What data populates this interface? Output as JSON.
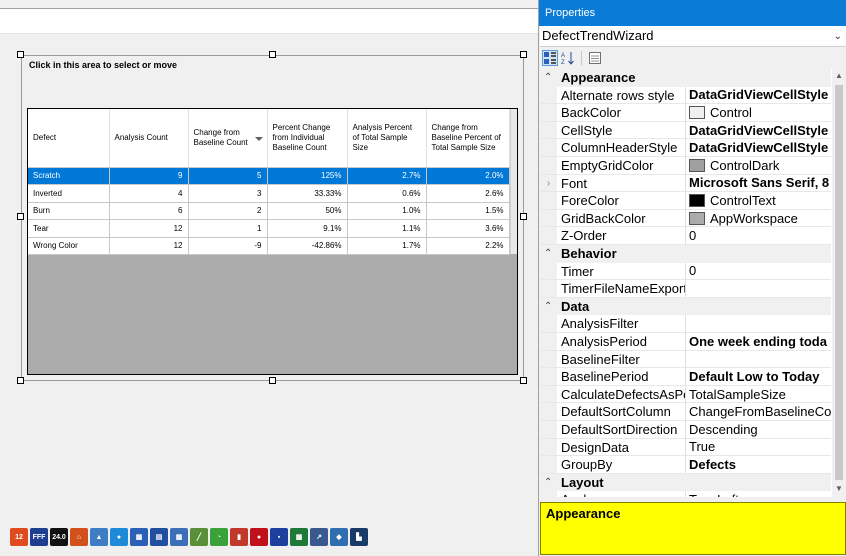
{
  "designer": {
    "select_hint": "Click in this area to select or move",
    "grid": {
      "columns": [
        "Defect",
        "Analysis Count",
        "Change from Baseline Count",
        "Percent Change from Individual Baseline Count",
        "Analysis Percent of Total Sample Size",
        "Change from Baseline Percent of Total Sample Size"
      ],
      "rows": [
        [
          "Scratch",
          "9",
          "5",
          "125%",
          "2.7%",
          "2.0%"
        ],
        [
          "Inverted",
          "4",
          "3",
          "33.33%",
          "0.6%",
          "2.6%"
        ],
        [
          "Burn",
          "6",
          "2",
          "50%",
          "1.0%",
          "1.5%"
        ],
        [
          "Tear",
          "12",
          "1",
          "9.1%",
          "1.1%",
          "3.6%"
        ],
        [
          "Wrong Color",
          "12",
          "-9",
          "-42.86%",
          "1.7%",
          "2.2%"
        ]
      ]
    }
  },
  "toolbox": {
    "icons": [
      {
        "name": "calendar-icon",
        "glyph": "12",
        "color": "#e04a1f"
      },
      {
        "name": "fff-text-icon",
        "glyph": "FFF",
        "color": "#1e3f8f"
      },
      {
        "name": "digital-display-icon",
        "glyph": "24.0",
        "color": "#111111"
      },
      {
        "name": "house-icon",
        "glyph": "⌂",
        "color": "#d1501c"
      },
      {
        "name": "picture-icon",
        "glyph": "▲",
        "color": "#3e7dc4"
      },
      {
        "name": "globe-icon",
        "glyph": "●",
        "color": "#1f8ad8"
      },
      {
        "name": "table-icon",
        "glyph": "▦",
        "color": "#2b5fb8"
      },
      {
        "name": "grid-icon",
        "glyph": "▤",
        "color": "#1f4f9e"
      },
      {
        "name": "datagrid-icon",
        "glyph": "▦",
        "color": "#3d6fb8"
      },
      {
        "name": "line-chart-icon",
        "glyph": "╱",
        "color": "#5a8f3a"
      },
      {
        "name": "gauge-icon",
        "glyph": "◔",
        "color": "#3aa23a"
      },
      {
        "name": "bar-indicator-icon",
        "glyph": "▮",
        "color": "#c0392b"
      },
      {
        "name": "stop-icon",
        "glyph": "●",
        "color": "#c0101a"
      },
      {
        "name": "scatter-icon",
        "glyph": "▪",
        "color": "#1f3f9e"
      },
      {
        "name": "block-grid-icon",
        "glyph": "▦",
        "color": "#1f7a3a"
      },
      {
        "name": "trend-chart-icon",
        "glyph": "↗",
        "color": "#3a5a8f"
      },
      {
        "name": "python-icon",
        "glyph": "◆",
        "color": "#2f6fb0"
      },
      {
        "name": "bar-chart-icon",
        "glyph": "▙",
        "color": "#1a3a6a"
      }
    ]
  },
  "properties": {
    "title": "Properties",
    "object_name": "DefectTrendWizard",
    "toolbar": {
      "categorized": "categorized-icon",
      "alphabetical": "alphabetical-sort-icon",
      "property_pages": "property-pages-icon"
    },
    "rows": [
      {
        "kind": "category",
        "label": "Appearance"
      },
      {
        "kind": "prop",
        "name": "Alternate rows style",
        "value": "DataGridViewCellStyle",
        "bold": true
      },
      {
        "kind": "prop",
        "name": "BackColor",
        "value": "Control",
        "swatch": "#f0f0f0"
      },
      {
        "kind": "prop",
        "name": "CellStyle",
        "value": "DataGridViewCellStyle",
        "bold": true
      },
      {
        "kind": "prop",
        "name": "ColumnHeaderStyle",
        "value": "DataGridViewCellStyle",
        "bold": true
      },
      {
        "kind": "prop",
        "name": "EmptyGridColor",
        "value": "ControlDark",
        "swatch": "#a0a0a0"
      },
      {
        "kind": "prop",
        "name": "Font",
        "value": "Microsoft Sans Serif, 8",
        "bold": true,
        "expandable": true
      },
      {
        "kind": "prop",
        "name": "ForeColor",
        "value": "ControlText",
        "swatch": "#000000"
      },
      {
        "kind": "prop",
        "name": "GridBackColor",
        "value": "AppWorkspace",
        "swatch": "#ababab"
      },
      {
        "kind": "prop",
        "name": "Z-Order",
        "value": "0"
      },
      {
        "kind": "category",
        "label": "Behavior"
      },
      {
        "kind": "prop",
        "name": "Timer",
        "value": "0"
      },
      {
        "kind": "prop",
        "name": "TimerFileNameExport",
        "value": ""
      },
      {
        "kind": "category",
        "label": "Data"
      },
      {
        "kind": "prop",
        "name": "AnalysisFilter",
        "value": ""
      },
      {
        "kind": "prop",
        "name": "AnalysisPeriod",
        "value": "One week ending toda",
        "bold": true
      },
      {
        "kind": "prop",
        "name": "BaselineFilter",
        "value": ""
      },
      {
        "kind": "prop",
        "name": "BaselinePeriod",
        "value": "Default Low to Today",
        "bold": true
      },
      {
        "kind": "prop",
        "name": "CalculateDefectsAsPe",
        "value": "TotalSampleSize"
      },
      {
        "kind": "prop",
        "name": "DefaultSortColumn",
        "value": "ChangeFromBaselineCou"
      },
      {
        "kind": "prop",
        "name": "DefaultSortDirection",
        "value": "Descending"
      },
      {
        "kind": "prop",
        "name": "DesignData",
        "value": "True"
      },
      {
        "kind": "prop",
        "name": "GroupBy",
        "value": "Defects",
        "bold": true
      },
      {
        "kind": "category",
        "label": "Layout"
      },
      {
        "kind": "prop",
        "name": "Anchor",
        "value": "Top, Left"
      }
    ],
    "description": {
      "title": "Appearance"
    }
  }
}
